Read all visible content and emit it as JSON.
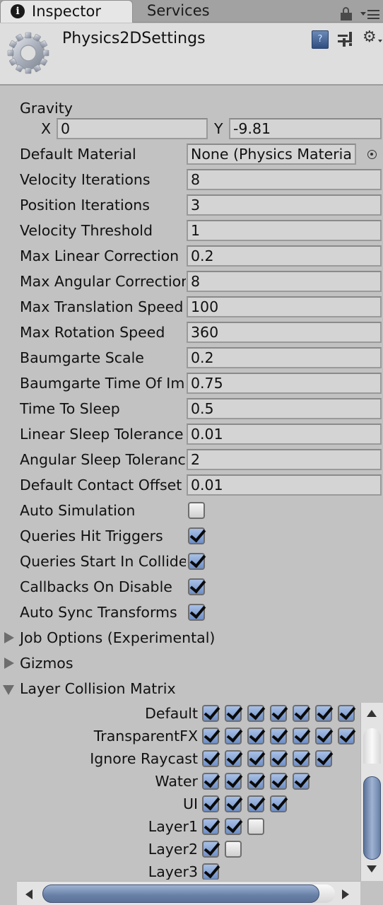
{
  "tabs": [
    {
      "label": "Inspector",
      "icon": "info-icon",
      "active": true
    },
    {
      "label": "Services",
      "active": false
    }
  ],
  "header": {
    "title": "Physics2DSettings",
    "icon": "gear-icon"
  },
  "gravity": {
    "label": "Gravity",
    "x_label": "X",
    "x_value": "0",
    "y_label": "Y",
    "y_value": "-9.81"
  },
  "default_material": {
    "label": "Default Material",
    "value": "None (Physics Materia"
  },
  "fields": [
    {
      "label": "Velocity Iterations",
      "value": "8"
    },
    {
      "label": "Position Iterations",
      "value": "3"
    },
    {
      "label": "Velocity Threshold",
      "value": "1"
    },
    {
      "label": "Max Linear Correction",
      "value": "0.2"
    },
    {
      "label": "Max Angular Correction",
      "value": "8"
    },
    {
      "label": "Max Translation Speed",
      "value": "100"
    },
    {
      "label": "Max Rotation Speed",
      "value": "360"
    },
    {
      "label": "Baumgarte Scale",
      "value": "0.2"
    },
    {
      "label": "Baumgarte Time Of Impact Scale",
      "value": "0.75"
    },
    {
      "label": "Time To Sleep",
      "value": "0.5"
    },
    {
      "label": "Linear Sleep Tolerance",
      "value": "0.01"
    },
    {
      "label": "Angular Sleep Tolerance",
      "value": "2"
    },
    {
      "label": "Default Contact Offset",
      "value": "0.01"
    }
  ],
  "toggles": [
    {
      "label": "Auto Simulation",
      "checked": false
    },
    {
      "label": "Queries Hit Triggers",
      "checked": true
    },
    {
      "label": "Queries Start In Colliders",
      "checked": true
    },
    {
      "label": "Callbacks On Disable",
      "checked": true
    },
    {
      "label": "Auto Sync Transforms",
      "checked": true
    }
  ],
  "foldouts": [
    {
      "label": "Job Options (Experimental)",
      "expanded": false
    },
    {
      "label": "Gizmos",
      "expanded": false
    },
    {
      "label": "Layer Collision Matrix",
      "expanded": true
    }
  ],
  "matrix": {
    "rows": [
      {
        "label": "Default",
        "values": [
          true,
          true,
          true,
          true,
          true,
          true,
          true
        ]
      },
      {
        "label": "TransparentFX",
        "values": [
          true,
          true,
          true,
          true,
          true,
          true,
          true
        ]
      },
      {
        "label": "Ignore Raycast",
        "values": [
          true,
          true,
          true,
          true,
          true,
          true
        ]
      },
      {
        "label": "Water",
        "values": [
          true,
          true,
          true,
          true,
          true
        ]
      },
      {
        "label": "UI",
        "values": [
          true,
          true,
          true,
          true
        ]
      },
      {
        "label": "Layer1",
        "values": [
          true,
          true,
          false
        ]
      },
      {
        "label": "Layer2",
        "values": [
          true,
          false
        ]
      },
      {
        "label": "Layer3",
        "values": [
          true
        ]
      }
    ]
  }
}
